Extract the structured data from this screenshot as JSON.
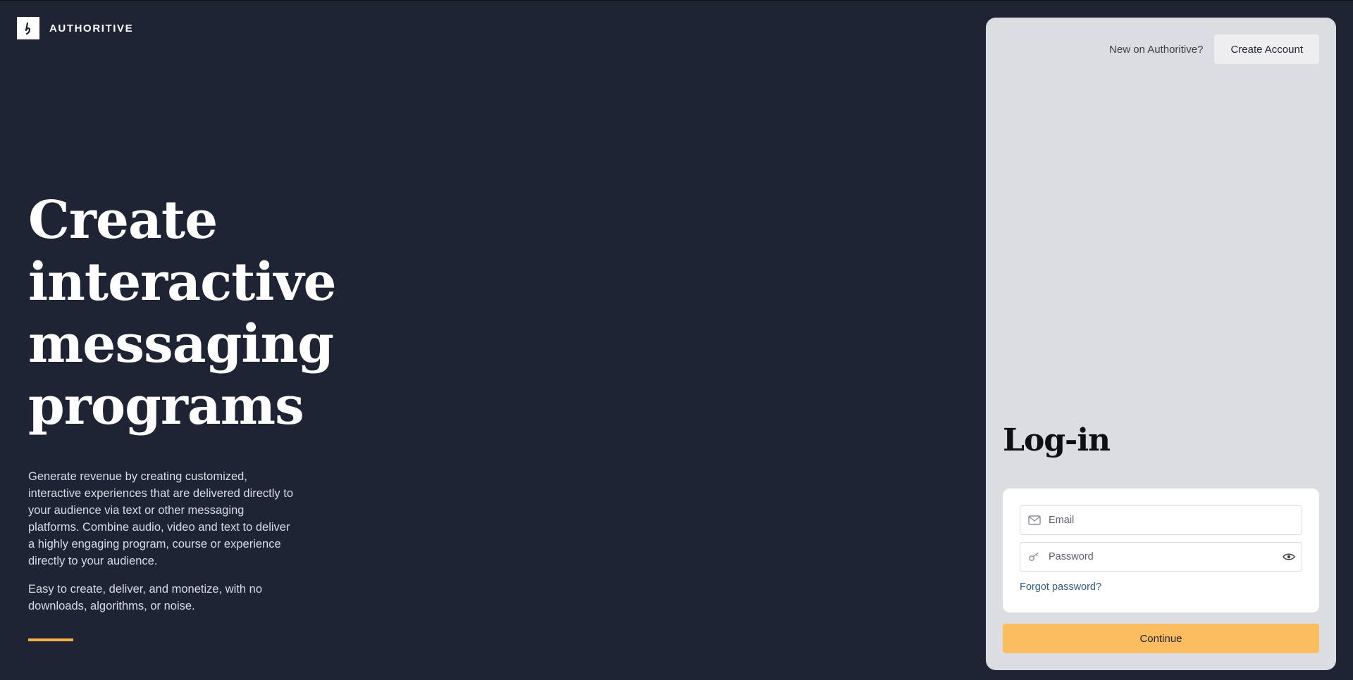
{
  "brand": {
    "name": "AUTHORITIVE",
    "logo_icon": "authoritive-logo-icon"
  },
  "hero": {
    "title_lines": [
      "Create",
      "interactive",
      "messaging",
      "programs"
    ],
    "description": "Generate revenue by creating customized, interactive experiences that are delivered directly to your audience via text or other messaging platforms. Combine audio, video and text to deliver a highly engaging program, course or experience directly to your audience.",
    "description2": "Easy to create, deliver, and monetize, with no downloads, algorithms, or noise."
  },
  "panel": {
    "new_prompt": "New on Authoritive?",
    "create_account_label": "Create Account",
    "login_title": "Log-in",
    "email": {
      "placeholder": "Email",
      "value": "",
      "icon": "mail-icon"
    },
    "password": {
      "placeholder": "Password",
      "value": "",
      "icon": "key-icon",
      "toggle_icon": "eye-icon"
    },
    "forgot_label": "Forgot password?",
    "continue_label": "Continue"
  },
  "colors": {
    "background": "#1f2434",
    "panel": "#dcdde0",
    "accent": "#fbbd5d",
    "link": "#2f5e8c"
  }
}
